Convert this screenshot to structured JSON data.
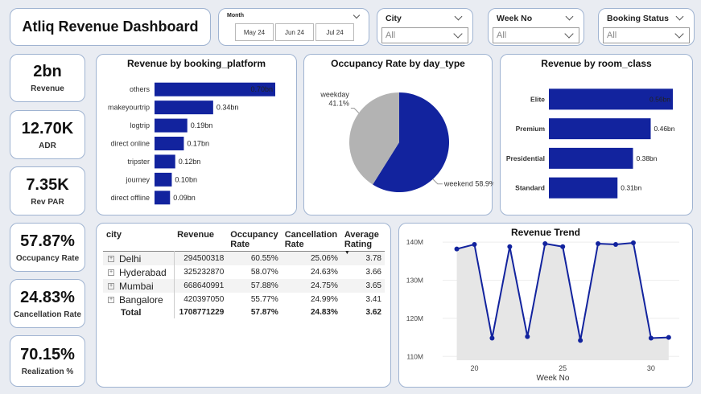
{
  "header": {
    "title": "Atliq Revenue Dashboard"
  },
  "filters": {
    "month": {
      "label": "Month",
      "options": [
        "May 24",
        "Jun 24",
        "Jul 24"
      ]
    },
    "city": {
      "label": "City",
      "value": "All"
    },
    "week_no": {
      "label": "Week No",
      "value": "All"
    },
    "booking_status": {
      "label": "Booking Status",
      "value": "All"
    }
  },
  "kpis": [
    {
      "value": "2bn",
      "label": "Revenue"
    },
    {
      "value": "12.70K",
      "label": "ADR"
    },
    {
      "value": "7.35K",
      "label": "Rev PAR"
    },
    {
      "value": "57.87%",
      "label": "Occupancy Rate"
    },
    {
      "value": "24.83%",
      "label": "Cancellation Rate"
    },
    {
      "value": "70.15%",
      "label": "Realization %"
    }
  ],
  "colors": {
    "bar": "#12239e",
    "pie_weekday": "#b3b3b3",
    "line": "#12239e",
    "area": "#e6e6e6",
    "card_border": "#9fb3d1"
  },
  "table": {
    "columns": [
      "city",
      "Revenue",
      "Occupancy Rate",
      "Cancellation Rate",
      "Average Rating"
    ],
    "rows": [
      {
        "city": "Delhi",
        "revenue": "294500318",
        "occupancy": "60.55%",
        "cancellation": "25.06%",
        "rating": "3.78"
      },
      {
        "city": "Hyderabad",
        "revenue": "325232870",
        "occupancy": "58.07%",
        "cancellation": "24.63%",
        "rating": "3.66"
      },
      {
        "city": "Mumbai",
        "revenue": "668640991",
        "occupancy": "57.88%",
        "cancellation": "24.75%",
        "rating": "3.65"
      },
      {
        "city": "Bangalore",
        "revenue": "420397050",
        "occupancy": "55.77%",
        "cancellation": "24.99%",
        "rating": "3.41"
      }
    ],
    "total": {
      "city": "Total",
      "revenue": "1708771229",
      "occupancy": "57.87%",
      "cancellation": "24.83%",
      "rating": "3.62"
    }
  },
  "chart_data": [
    {
      "type": "bar",
      "title": "Revenue by booking_platform",
      "categories": [
        "others",
        "makeyourtrip",
        "logtrip",
        "direct online",
        "tripster",
        "journey",
        "direct offline"
      ],
      "values": [
        0.7,
        0.34,
        0.19,
        0.17,
        0.12,
        0.1,
        0.09
      ],
      "labels": [
        "0.70bn",
        "0.34bn",
        "0.19bn",
        "0.17bn",
        "0.12bn",
        "0.10bn",
        "0.09bn"
      ],
      "orientation": "horizontal"
    },
    {
      "type": "pie",
      "title": "Occupancy Rate by day_type",
      "slices": [
        {
          "name": "weekend",
          "value": 58.9,
          "label": "weekend 58.9%"
        },
        {
          "name": "weekday",
          "value": 41.1,
          "label": "weekday 41.1%"
        }
      ]
    },
    {
      "type": "bar",
      "title": "Revenue by room_class",
      "categories": [
        "Elite",
        "Premium",
        "Presidential",
        "Standard"
      ],
      "values": [
        0.56,
        0.46,
        0.38,
        0.31
      ],
      "labels": [
        "0.56bn",
        "0.46bn",
        "0.38bn",
        "0.31bn"
      ],
      "orientation": "horizontal"
    },
    {
      "type": "area",
      "title": "Revenue Trend",
      "xlabel": "Week No",
      "x": [
        19,
        20,
        21,
        22,
        23,
        24,
        25,
        26,
        27,
        28,
        29,
        30,
        31
      ],
      "values": [
        138.2,
        139.4,
        114.8,
        138.8,
        115.2,
        139.6,
        138.8,
        114.2,
        139.6,
        139.4,
        139.8,
        114.8,
        115.0
      ],
      "xticks": [
        20,
        25,
        30
      ],
      "yticks": [
        110,
        120,
        130,
        140
      ],
      "ytick_labels": [
        "110M",
        "120M",
        "130M",
        "140M"
      ],
      "ylim": [
        109,
        141.5
      ],
      "xlim": [
        18.2,
        31.6
      ]
    }
  ]
}
